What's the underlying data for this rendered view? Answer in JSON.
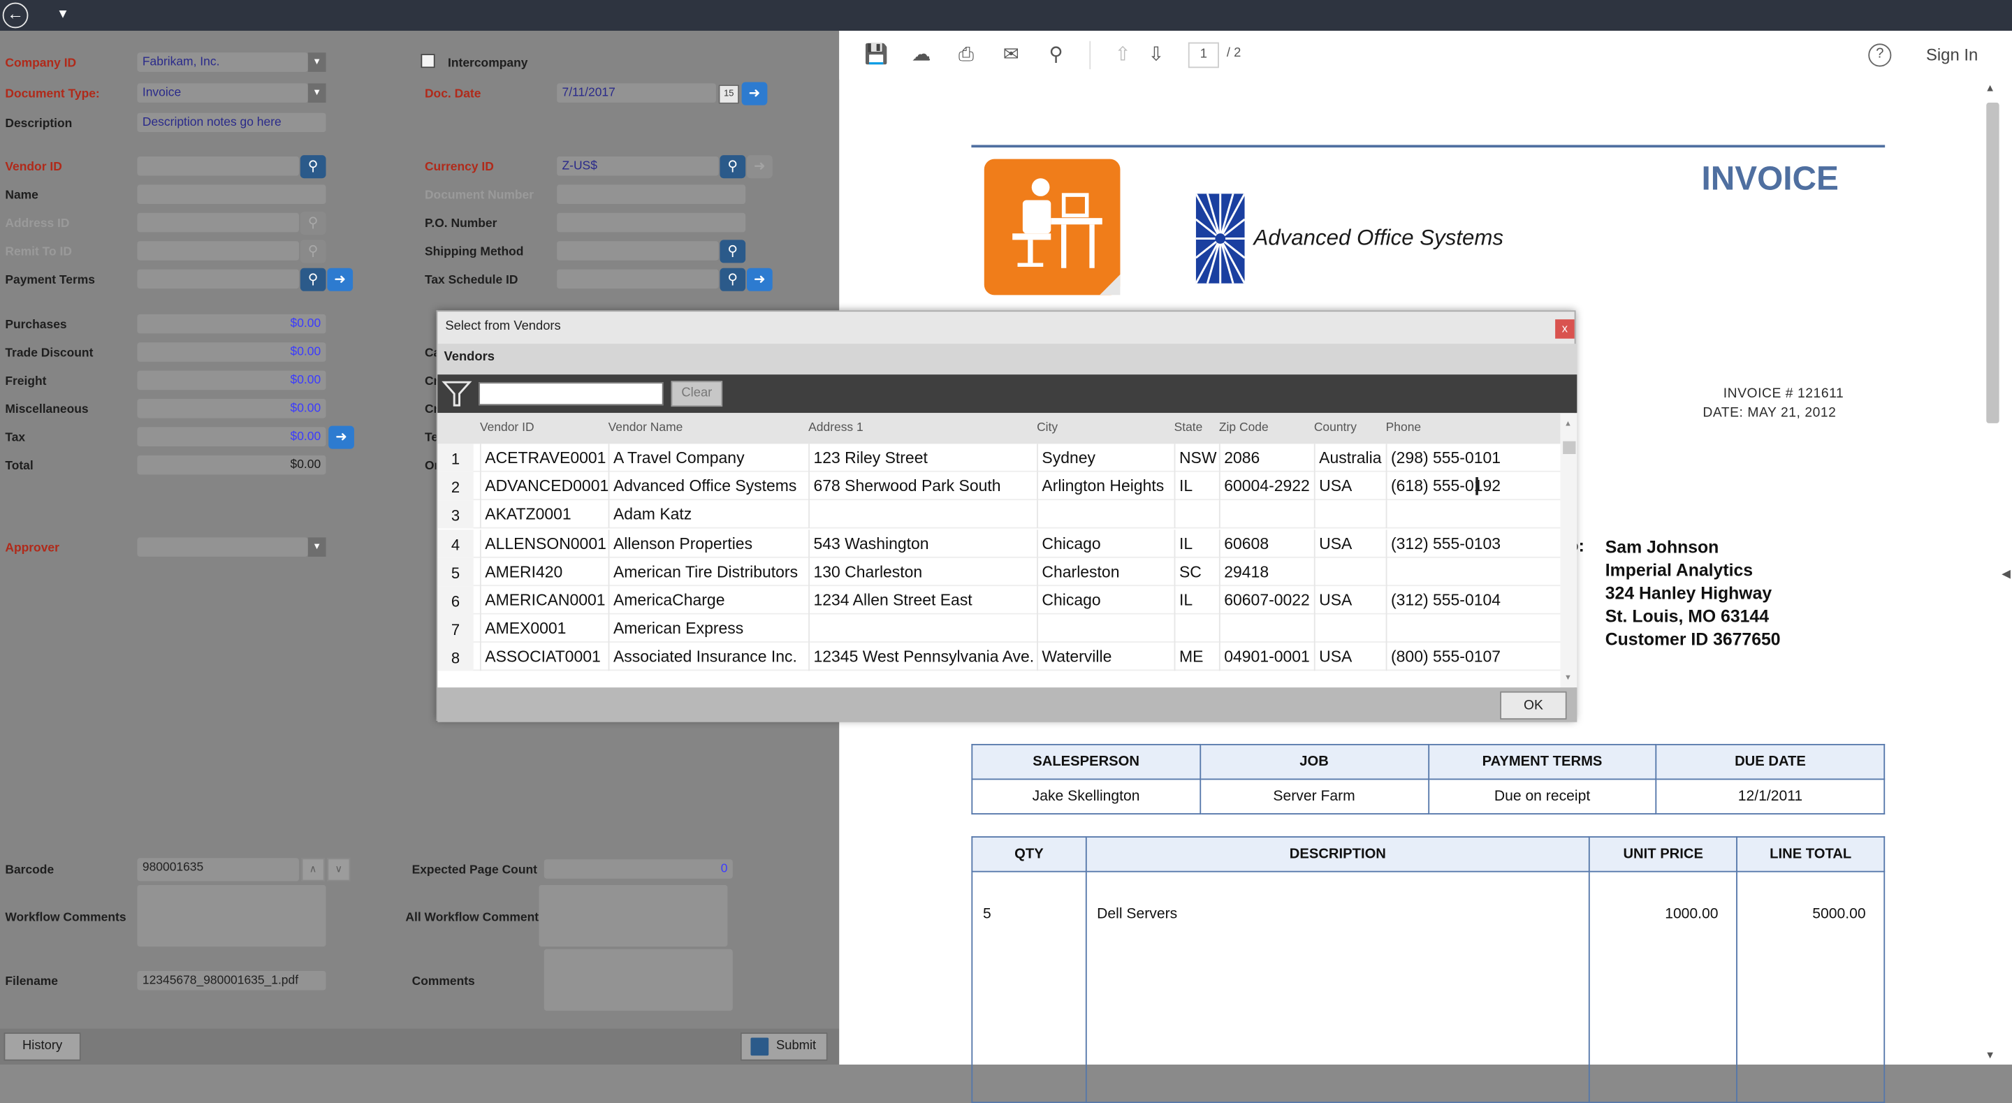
{
  "toolbar": {
    "back_icon": "back-arrow-icon",
    "menu_caret_icon": "caret-down-icon"
  },
  "form": {
    "company_id": {
      "label": "Company ID",
      "value": "Fabrikam, Inc."
    },
    "intercompany": {
      "label": "Intercompany",
      "checked": false
    },
    "document_type": {
      "label": "Document Type:",
      "value": "Invoice"
    },
    "doc_date": {
      "label": "Doc. Date",
      "value": "7/11/2017"
    },
    "description": {
      "label": "Description",
      "value": "Description notes go here"
    },
    "vendor_id": {
      "label": "Vendor ID",
      "value": ""
    },
    "currency_id": {
      "label": "Currency ID",
      "value": "Z-US$"
    },
    "name": {
      "label": "Name",
      "value": ""
    },
    "document_number": {
      "label": "Document Number",
      "value": ""
    },
    "address_id": {
      "label": "Address ID",
      "value": ""
    },
    "po_number": {
      "label": "P.O. Number",
      "value": ""
    },
    "remit_to_id": {
      "label": "Remit To ID",
      "value": ""
    },
    "shipping_method": {
      "label": "Shipping Method",
      "value": ""
    },
    "payment_terms": {
      "label": "Payment Terms",
      "value": ""
    },
    "tax_schedule_id": {
      "label": "Tax Schedule ID",
      "value": ""
    },
    "purchases": {
      "label": "Purchases",
      "value": "$0.00"
    },
    "trade_discount": {
      "label": "Trade Discount",
      "value": "$0.00"
    },
    "freight": {
      "label": "Freight",
      "value": "$0.00"
    },
    "miscellaneous": {
      "label": "Miscellaneous",
      "value": "$0.00"
    },
    "tax": {
      "label": "Tax",
      "value": "$0.00"
    },
    "total": {
      "label": "Total",
      "value": "$0.00"
    },
    "approver": {
      "label": "Approver",
      "value": ""
    },
    "barcode": {
      "label": "Barcode",
      "value": "980001635"
    },
    "expected_page_count": {
      "label": "Expected Page Count",
      "value": "0"
    },
    "workflow_comments": {
      "label": "Workflow Comments",
      "value": ""
    },
    "all_workflow_comments": {
      "label": "All Workflow Comment",
      "value": ""
    },
    "filename": {
      "label": "Filename",
      "value": "12345678_980001635_1.pdf"
    },
    "comments": {
      "label": "Comments",
      "value": ""
    },
    "partial_labels": [
      "Ca",
      "Cr",
      "Cr",
      "Te",
      "Or"
    ],
    "history_button": "History",
    "submit_button": "Submit"
  },
  "viewer": {
    "icons": [
      "save-icon",
      "upload-icon",
      "print-icon",
      "mail-icon",
      "search-icon",
      "page-up-icon",
      "page-down-icon"
    ],
    "page_current": "1",
    "page_total": "/ 2",
    "help_icon": "help-circle-icon",
    "sign_in": "Sign In"
  },
  "invoice": {
    "title": "INVOICE",
    "company_name": "Advanced Office Systems",
    "invoice_number": "INVOICE # 121611",
    "date": "DATE: MAY 21, 2012",
    "bill_to_prefix": "o:",
    "bill_to": {
      "name": "Sam Johnson",
      "company": "Imperial Analytics",
      "street": "324 Hanley Highway",
      "city": "St. Louis, MO 63144",
      "customer": "Customer ID 3677650"
    },
    "terms_headers": [
      "SALESPERSON",
      "JOB",
      "PAYMENT TERMS",
      "DUE DATE"
    ],
    "terms_values": [
      "Jake Skellington",
      "Server Farm",
      "Due on receipt",
      "12/1/2011"
    ],
    "items_headers": [
      "QTY",
      "DESCRIPTION",
      "UNIT PRICE",
      "LINE TOTAL"
    ],
    "items": [
      {
        "qty": "5",
        "description": "Dell Servers",
        "unit_price": "1000.00",
        "line_total": "5000.00"
      }
    ]
  },
  "dialog": {
    "title": "Select from Vendors",
    "close": "x",
    "tab": "Vendors",
    "filter_placeholder": "",
    "clear": "Clear",
    "ok": "OK",
    "columns": [
      "Vendor ID",
      "Vendor Name",
      "Address 1",
      "City",
      "State",
      "Zip Code",
      "Country",
      "Phone"
    ],
    "rows": [
      {
        "n": "1",
        "id": "ACETRAVE0001",
        "name": "A Travel Company",
        "address": "123 Riley Street",
        "city": "Sydney",
        "state": "NSW",
        "zip": "2086",
        "country": "Australia",
        "phone": "(298) 555-0101"
      },
      {
        "n": "2",
        "id": "ADVANCED0001",
        "name": "Advanced Office Systems",
        "address": "678 Sherwood Park South",
        "city": "Arlington Heights",
        "state": "IL",
        "zip": "60004-2922",
        "country": "USA",
        "phone": "(618) 555-0192"
      },
      {
        "n": "3",
        "id": "AKATZ0001",
        "name": "Adam Katz",
        "address": "",
        "city": "",
        "state": "",
        "zip": "",
        "country": "",
        "phone": ""
      },
      {
        "n": "4",
        "id": "ALLENSON0001",
        "name": "Allenson Properties",
        "address": "543 Washington",
        "city": "Chicago",
        "state": "IL",
        "zip": "60608",
        "country": "USA",
        "phone": "(312) 555-0103"
      },
      {
        "n": "5",
        "id": "AMERI420",
        "name": "American Tire Distributors",
        "address": "130 Charleston",
        "city": "Charleston",
        "state": "SC",
        "zip": "29418",
        "country": "",
        "phone": ""
      },
      {
        "n": "6",
        "id": "AMERICAN0001",
        "name": "AmericaCharge",
        "address": "1234 Allen Street East",
        "city": "Chicago",
        "state": "IL",
        "zip": "60607-0022",
        "country": "USA",
        "phone": "(312) 555-0104"
      },
      {
        "n": "7",
        "id": "AMEX0001",
        "name": "American Express",
        "address": "",
        "city": "",
        "state": "",
        "zip": "",
        "country": "",
        "phone": ""
      },
      {
        "n": "8",
        "id": "ASSOCIAT0001",
        "name": "Associated Insurance Inc.",
        "address": "12345 West Pennsylvania Ave.",
        "city": "Waterville",
        "state": "ME",
        "zip": "04901-0001",
        "country": "USA",
        "phone": "(800) 555-0107"
      }
    ]
  }
}
